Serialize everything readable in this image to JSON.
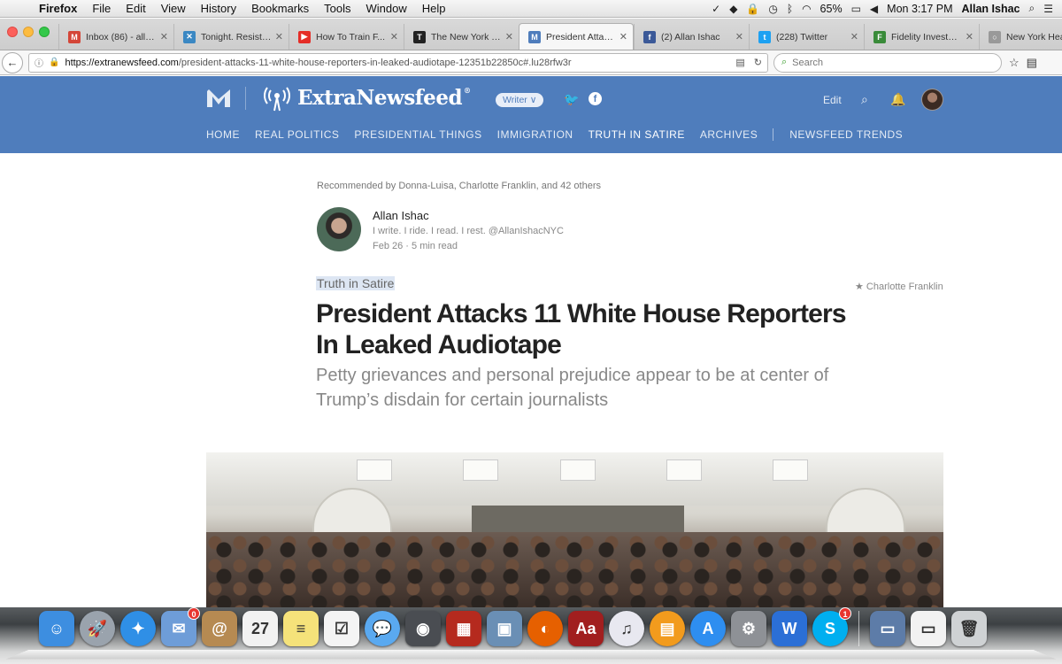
{
  "menubar": {
    "app": "Firefox",
    "items": [
      "File",
      "Edit",
      "View",
      "History",
      "Bookmarks",
      "Tools",
      "Window",
      "Help"
    ],
    "battery": "65%",
    "clock": "Mon 3:17 PM",
    "user": "Allan Ishac"
  },
  "tabs": [
    {
      "label": "Inbox (86) - alla...",
      "icon": "gmail-icon",
      "color": "#d44638",
      "glyph": "M"
    },
    {
      "label": "Tonight. Resista...",
      "icon": "x-icon",
      "color": "#3b88c3",
      "glyph": "✕"
    },
    {
      "label": "How To Train F...",
      "icon": "youtube-icon",
      "color": "#e52d27",
      "glyph": "▶"
    },
    {
      "label": "The New York T...",
      "icon": "nyt-icon",
      "color": "#222222",
      "glyph": "T"
    },
    {
      "label": "President Attack...",
      "icon": "medium-icon",
      "color": "#4f7dbc",
      "glyph": "M"
    },
    {
      "label": "(2) Allan Ishac",
      "icon": "facebook-icon",
      "color": "#3b5998",
      "glyph": "f"
    },
    {
      "label": "(228) Twitter",
      "icon": "twitter-icon",
      "color": "#1da1f2",
      "glyph": "t"
    },
    {
      "label": "Fidelity Investm...",
      "icon": "fidelity-icon",
      "color": "#3a8b3a",
      "glyph": "F"
    },
    {
      "label": "New York Heal",
      "icon": "loading-icon",
      "color": "#999999",
      "glyph": "○"
    }
  ],
  "active_tab": 4,
  "navbar": {
    "url_host": "https://extranewsfeed.com",
    "url_path": "/president-attacks-11-white-house-reporters-in-leaked-audiotape-12351b22850c#.lu28rfw3r",
    "search_placeholder": "Search"
  },
  "site": {
    "brand": "ExtraNewsfeed",
    "brand_mark": "®",
    "writer_label": "Writer ∨",
    "edit_label": "Edit",
    "nav": [
      "HOME",
      "REAL POLITICS",
      "PRESIDENTIAL THINGS",
      "IMMIGRATION",
      "TRUTH IN SATIRE",
      "ARCHIVES"
    ],
    "nav_extra": "NEWSFEED TRENDS",
    "active_nav": 4,
    "header_color": "#4f7dbc"
  },
  "article": {
    "recommended": "Recommended by Donna-Luisa, Charlotte Franklin, and 42 others",
    "author": "Allan Ishac",
    "bio": "I write. I ride. I read. I rest. @AllanIshacNYC",
    "meta": "Feb 26 · 5 min read",
    "section": "Truth in Satire",
    "starred_by": "★ Charlotte Franklin",
    "title": "President Attacks 11 White House Reporters In Leaked Audiotape",
    "subtitle": "Petty grievances and personal prejudice appear to be at center of Trump’s disdain for certain journalists"
  },
  "dock": [
    {
      "name": "finder-icon",
      "color": "#3d8ee0",
      "glyph": "☺"
    },
    {
      "name": "launchpad-icon",
      "color": "#9aa3ad",
      "glyph": "🚀",
      "round": true
    },
    {
      "name": "safari-icon",
      "color": "#2f8fe6",
      "glyph": "✦",
      "round": true
    },
    {
      "name": "mail-icon",
      "color": "#6e9dd8",
      "glyph": "✉",
      "badge": "0"
    },
    {
      "name": "contacts-icon",
      "color": "#b68a52",
      "glyph": "@"
    },
    {
      "name": "calendar-icon",
      "color": "#f2f2f2",
      "glyph": "27"
    },
    {
      "name": "notes-icon",
      "color": "#f5e27a",
      "glyph": "≡"
    },
    {
      "name": "reminders-icon",
      "color": "#f4f4f4",
      "glyph": "☑"
    },
    {
      "name": "messages-icon",
      "color": "#5aa9f0",
      "glyph": "💬",
      "round": true
    },
    {
      "name": "facetime-icon",
      "color": "#4a4d52",
      "glyph": "◉"
    },
    {
      "name": "photobooth-icon",
      "color": "#b52a1e",
      "glyph": "▦"
    },
    {
      "name": "iphoto-icon",
      "color": "#6a8fb5",
      "glyph": "▣"
    },
    {
      "name": "firefox-icon",
      "color": "#e66000",
      "glyph": "◐",
      "round": true
    },
    {
      "name": "dictionary-icon",
      "color": "#a11f1f",
      "glyph": "Aa"
    },
    {
      "name": "itunes-icon",
      "color": "#e8e8f0",
      "glyph": "♫",
      "round": true
    },
    {
      "name": "ibooks-icon",
      "color": "#f29b1d",
      "glyph": "▤",
      "round": true
    },
    {
      "name": "appstore-icon",
      "color": "#2e8ef0",
      "glyph": "A",
      "round": true
    },
    {
      "name": "system-preferences-icon",
      "color": "#8e9196",
      "glyph": "⚙"
    },
    {
      "name": "word-icon",
      "color": "#2b6fd6",
      "glyph": "W"
    },
    {
      "name": "skype-icon",
      "color": "#00aff0",
      "glyph": "S",
      "badge": "1",
      "round": true
    }
  ],
  "dock_right": [
    {
      "name": "recent-window-icon",
      "color": "#5d7ca8",
      "glyph": "▭"
    },
    {
      "name": "recent-document-icon",
      "color": "#f2f2f2",
      "glyph": "▭"
    },
    {
      "name": "trash-icon",
      "color": "#cfd2d4",
      "glyph": "🗑"
    }
  ]
}
